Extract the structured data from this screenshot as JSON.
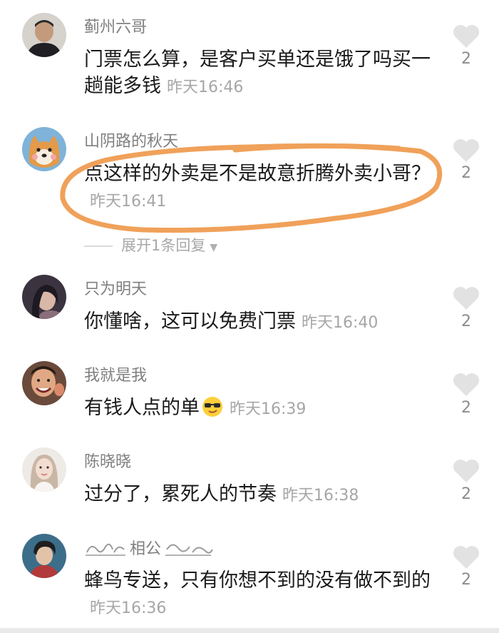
{
  "comments": [
    {
      "username": "蓟州六哥",
      "text": "门票怎么算，是客户买单还是饿了吗买一趟能多钱",
      "time": "昨天16:46",
      "likes": "2",
      "avatar": "avatar-man"
    },
    {
      "username": "山阴路的秋天",
      "text": "点这样的外卖是不是故意折腾外卖小哥？",
      "time": "昨天16:41",
      "likes": "2",
      "avatar": "avatar-shiba-dog",
      "reply_toggle": "展开1条回复"
    },
    {
      "username": "只为明天",
      "text": "你懂啥，这可以免费门票",
      "time": "昨天16:40",
      "likes": "2",
      "avatar": "avatar-woman-dark"
    },
    {
      "username": "我就是我",
      "text": "有钱人点的单",
      "time": "昨天16:39",
      "likes": "2",
      "avatar": "avatar-man-smiling",
      "emoji": "sunglasses-emoji"
    },
    {
      "username": "陈晓晓",
      "text": "过分了，累死人的节奏",
      "time": "昨天16:38",
      "likes": "2",
      "avatar": "avatar-woman-light"
    },
    {
      "username": "相公",
      "username_decoration": "ornamental-swirls",
      "text": "蜂鸟专送，只有你想不到的没有做不到的",
      "time": "昨天16:36",
      "likes": "2",
      "avatar": "avatar-man-scarf"
    }
  ],
  "annotation": {
    "shape": "hand-drawn-ellipse",
    "color": "#f0a15a",
    "target": "comment-2"
  },
  "colors": {
    "username": "#7f7f7f",
    "text": "#1a1a1a",
    "time": "#a6a6a6",
    "like_icon": "#e2e2e2"
  }
}
